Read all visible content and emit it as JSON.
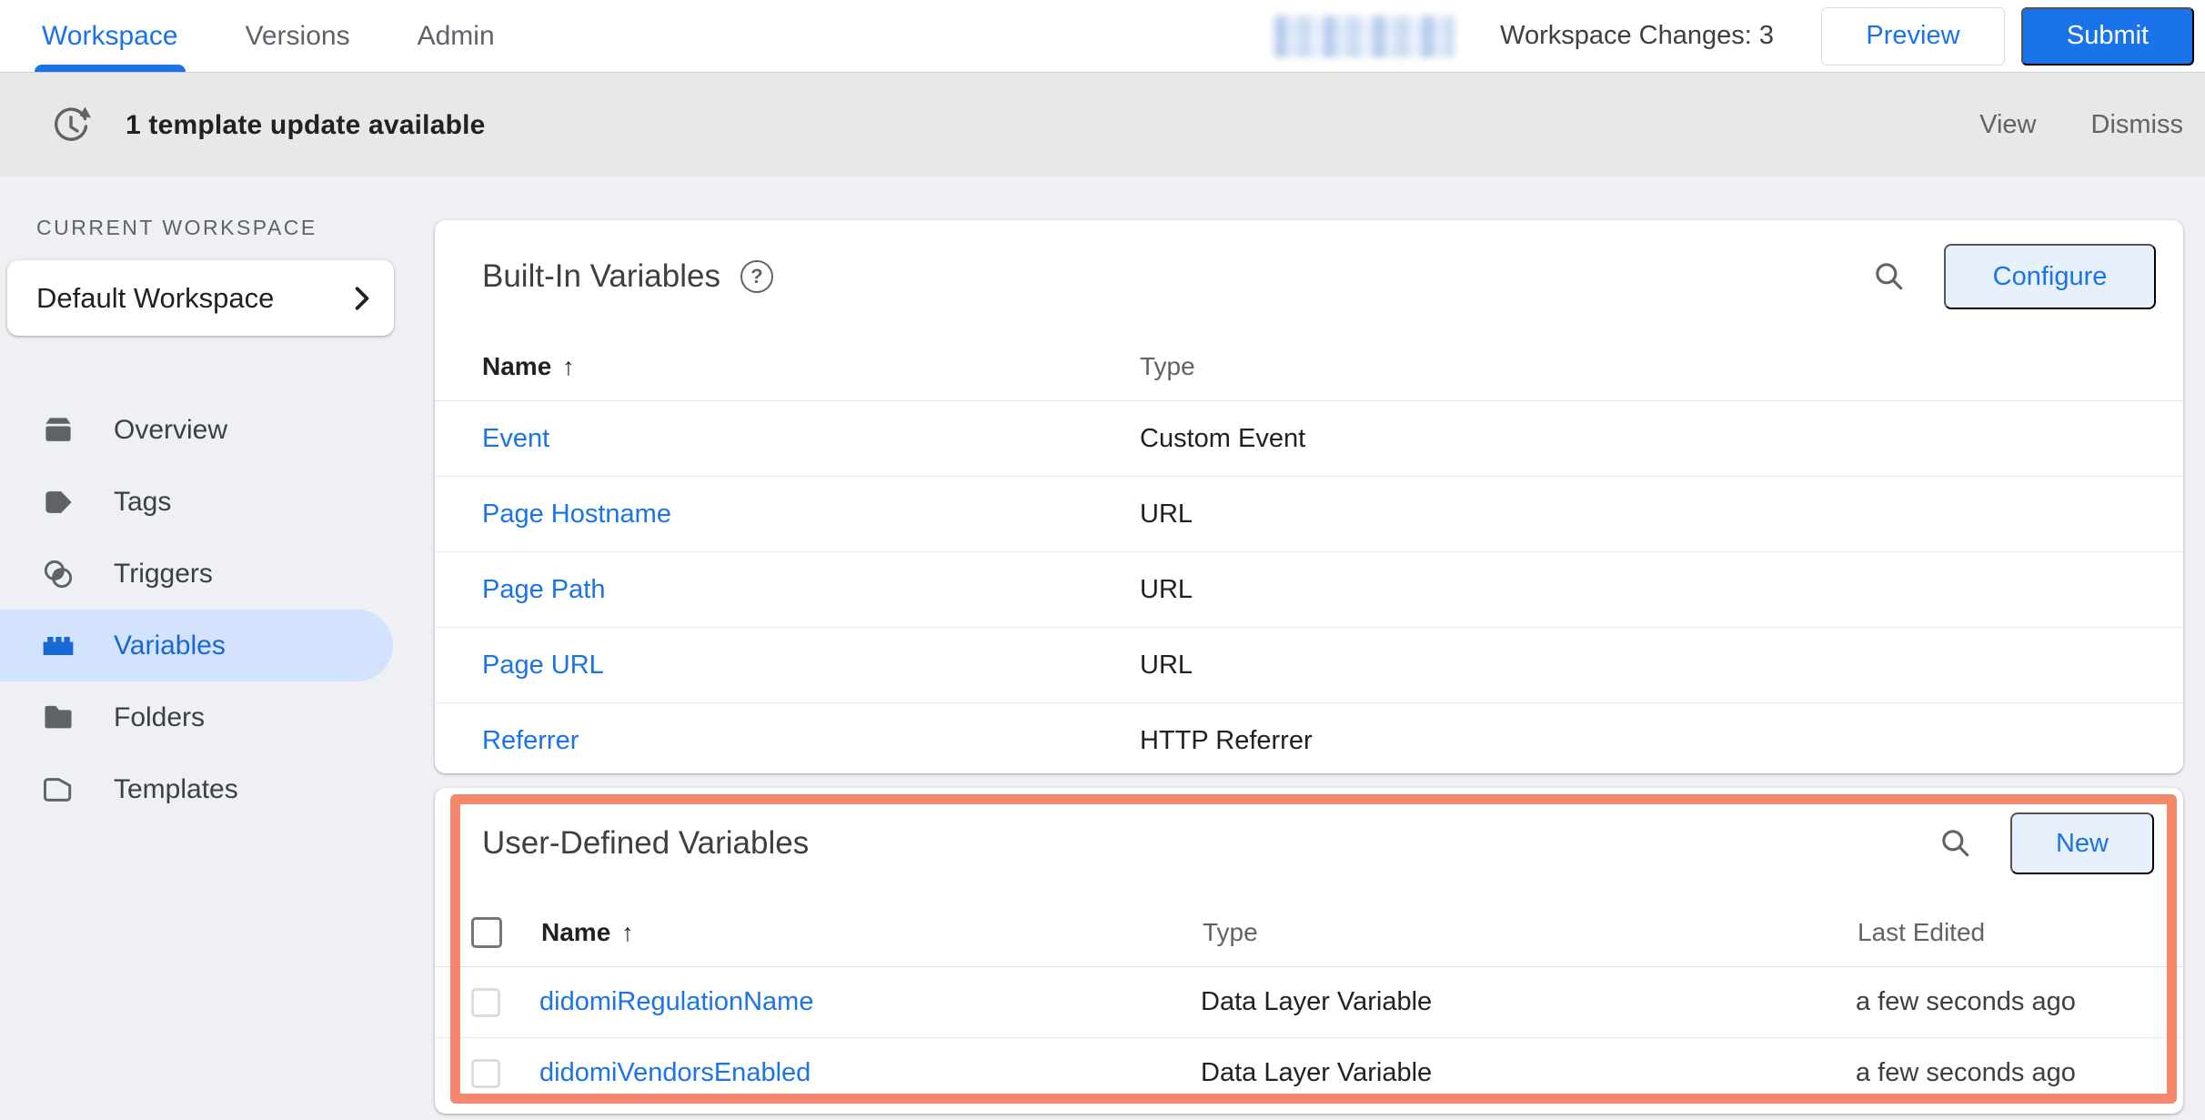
{
  "top_nav": {
    "tabs": [
      {
        "label": "Workspace",
        "active": true
      },
      {
        "label": "Versions",
        "active": false
      },
      {
        "label": "Admin",
        "active": false
      }
    ],
    "workspace_changes_label": "Workspace Changes: 3",
    "preview_button": "Preview",
    "submit_button": "Submit"
  },
  "notification_bar": {
    "message": "1 template update available",
    "view_action": "View",
    "dismiss_action": "Dismiss"
  },
  "sidebar": {
    "section_label": "CURRENT WORKSPACE",
    "workspace_selector": "Default Workspace",
    "items": [
      {
        "label": "Overview",
        "icon": "overview-icon",
        "active": false
      },
      {
        "label": "Tags",
        "icon": "tag-icon",
        "active": false
      },
      {
        "label": "Triggers",
        "icon": "triggers-icon",
        "active": false
      },
      {
        "label": "Variables",
        "icon": "variables-brick-icon",
        "active": true
      },
      {
        "label": "Folders",
        "icon": "folder-icon",
        "active": false
      },
      {
        "label": "Templates",
        "icon": "template-icon",
        "active": false
      }
    ]
  },
  "built_in_variables": {
    "title": "Built-In Variables",
    "help_glyph": "?",
    "configure_button": "Configure",
    "columns": {
      "name": "Name",
      "sort_indicator": "↑",
      "type": "Type"
    },
    "rows": [
      {
        "name": "Event",
        "type": "Custom Event"
      },
      {
        "name": "Page Hostname",
        "type": "URL"
      },
      {
        "name": "Page Path",
        "type": "URL"
      },
      {
        "name": "Page URL",
        "type": "URL"
      },
      {
        "name": "Referrer",
        "type": "HTTP Referrer"
      }
    ]
  },
  "user_defined_variables": {
    "title": "User-Defined Variables",
    "new_button": "New",
    "columns": {
      "name": "Name",
      "sort_indicator": "↑",
      "type": "Type",
      "last_edited": "Last Edited"
    },
    "rows": [
      {
        "name": "didomiRegulationName",
        "type": "Data Layer Variable",
        "last_edited": "a few seconds ago"
      },
      {
        "name": "didomiVendorsEnabled",
        "type": "Data Layer Variable",
        "last_edited": "a few seconds ago"
      }
    ]
  },
  "colors": {
    "accent_blue": "#1a73e8",
    "selected_nav_bg": "#d3e3fd",
    "selected_nav_text": "#1967d2",
    "chip_button_bg": "#e8f0fe",
    "highlight_border": "#f5886c",
    "page_bg": "#eef0f3",
    "notification_bg": "#e8e8e8"
  }
}
